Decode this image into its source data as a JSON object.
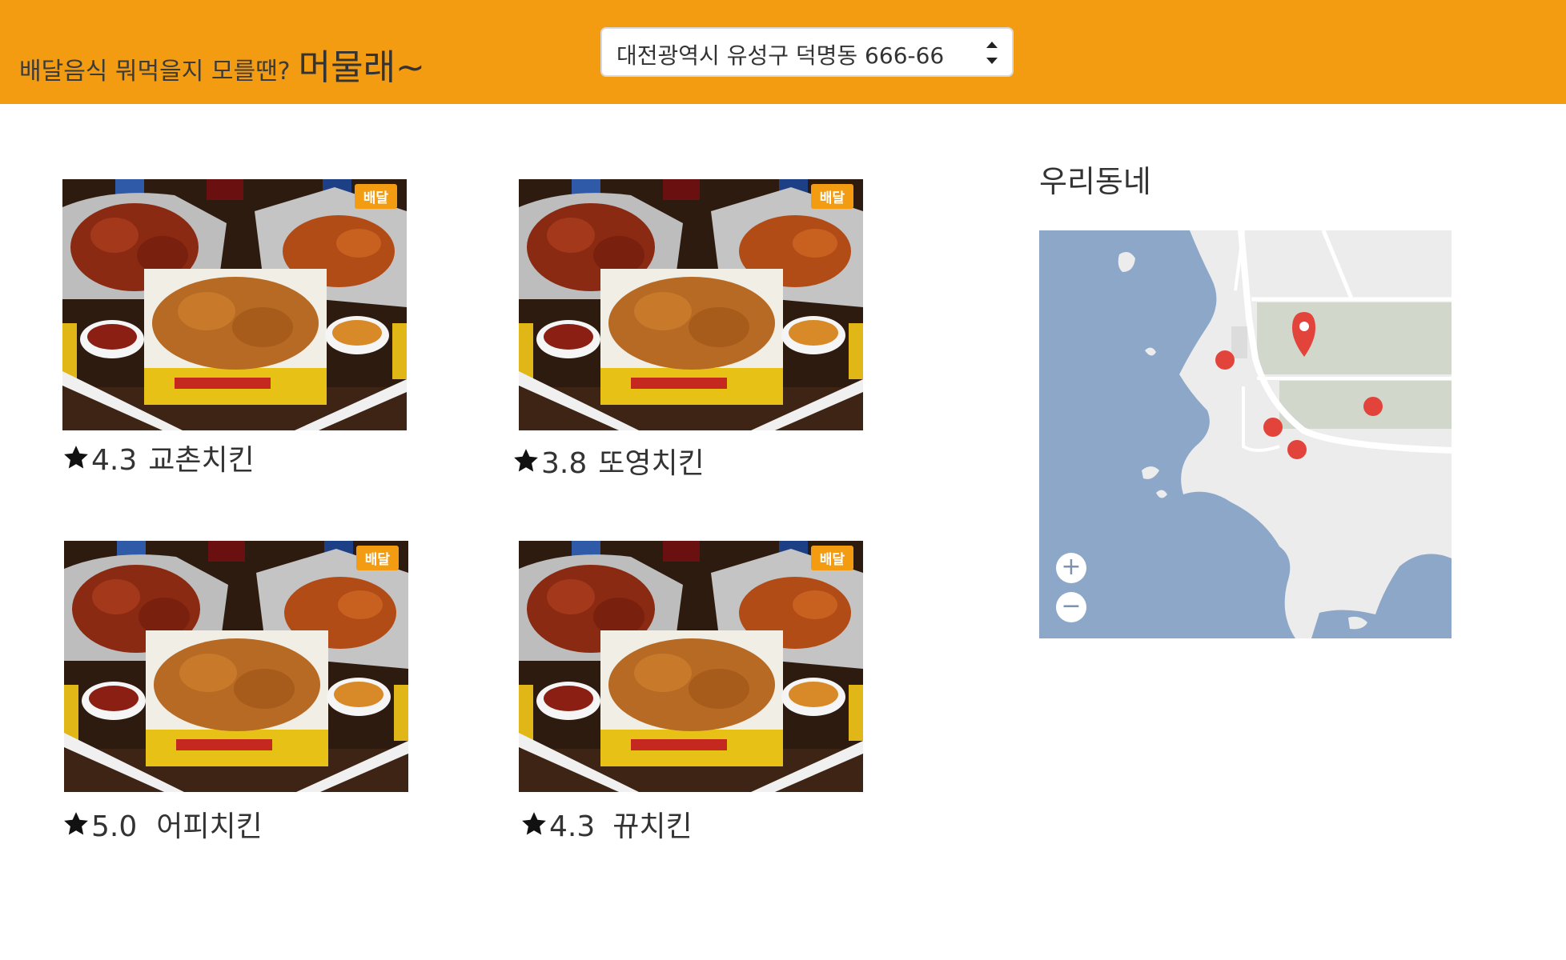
{
  "header": {
    "tagline": "배달음식 뭐먹을지 모를땐?",
    "brand_name": "머물래~",
    "address": "대전광역시 유성구 덕명동 666-66"
  },
  "restaurants": [
    {
      "rating": "4.3",
      "name": "교촌치킨",
      "badge": "배달"
    },
    {
      "rating": "3.8",
      "name": "또영치킨",
      "badge": "배달"
    },
    {
      "rating": "5.0",
      "name": "어피치킨",
      "badge": "배달"
    },
    {
      "rating": "4.3",
      "name": "뀨치킨",
      "badge": "배달"
    }
  ],
  "neighborhood": {
    "title": "우리동네",
    "map": {
      "zoom_in_label": "+",
      "zoom_out_label": "−"
    }
  },
  "colors": {
    "header_bg": "#f39c12",
    "water": "#8da7c8",
    "land": "#ececec",
    "marker": "#e2433a"
  },
  "icons": {
    "rating": "star-icon",
    "select": "sort-arrows-icon",
    "map_pin": "location-pin-icon",
    "map_marker": "marker-dot-icon"
  }
}
